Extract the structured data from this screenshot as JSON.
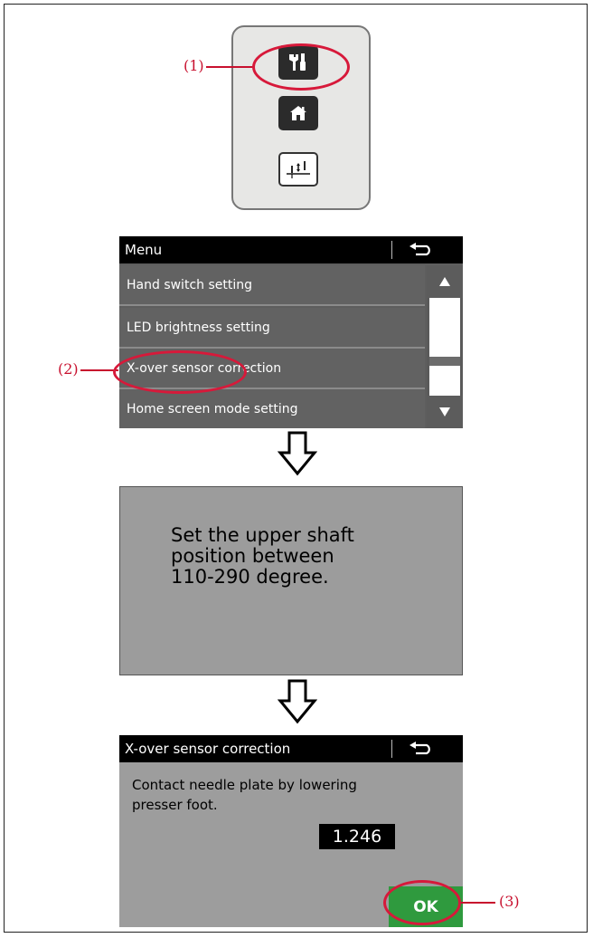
{
  "callouts": {
    "c1": "(1)",
    "c2": "(2)",
    "c3": "(3)"
  },
  "panel": {
    "buttons": [
      {
        "icon": "tools-icon"
      },
      {
        "icon": "home-icon"
      },
      {
        "icon": "needle-position-icon"
      }
    ]
  },
  "menu": {
    "title": "Menu",
    "back_icon": "back-arrow-icon",
    "items": [
      {
        "label": "Hand switch setting"
      },
      {
        "label": "LED brightness setting"
      },
      {
        "label": "X-over sensor correction"
      },
      {
        "label": "Home screen mode setting"
      }
    ],
    "scroll_up_icon": "triangle-up-icon",
    "scroll_down_icon": "triangle-down-icon"
  },
  "message": {
    "text": "Set the upper shaft\nposition between\n110-290 degree."
  },
  "correction": {
    "title": "X-over sensor correction",
    "instruction": "Contact needle plate by lowering\npresser foot.",
    "value": "1.246",
    "ok_label": "OK"
  },
  "colors": {
    "accent_red": "#c8102e",
    "ok_green": "#2f9a3e",
    "menu_bg": "#5e5e5e",
    "screen_gray": "#9c9c9c"
  }
}
